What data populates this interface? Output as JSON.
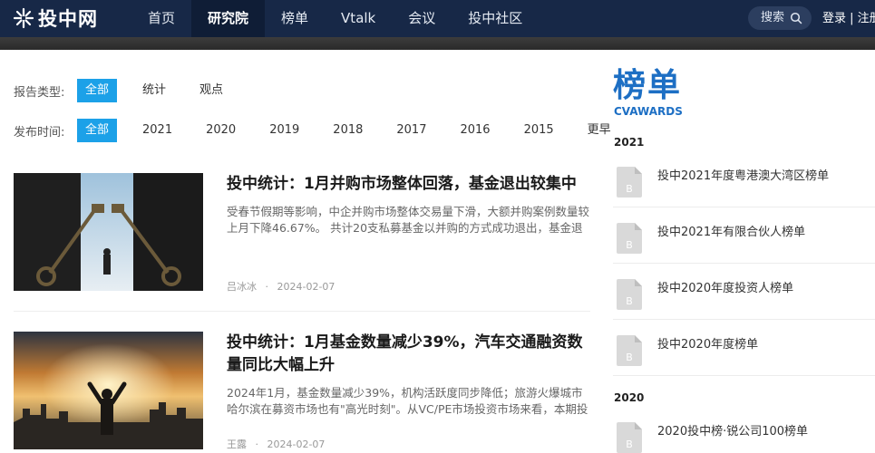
{
  "header": {
    "logo_text": "投中网",
    "nav": [
      {
        "label": "首页"
      },
      {
        "label": "研究院"
      },
      {
        "label": "榜单"
      },
      {
        "label": "Vtalk"
      },
      {
        "label": "会议"
      },
      {
        "label": "投中社区"
      }
    ],
    "active_nav": "研究院",
    "search_label": "搜索",
    "auth_label": "登录 | 注册"
  },
  "filters": {
    "type_label": "报告类型:",
    "type_options": [
      "全部",
      "统计",
      "观点"
    ],
    "time_label": "发布时间:",
    "time_options": [
      "全部",
      "2021",
      "2020",
      "2019",
      "2018",
      "2017",
      "2016",
      "2015",
      "更早"
    ],
    "active_color": "#1ca1e8"
  },
  "articles": [
    {
      "title": "投中统计：1月并购市场整体回落，基金退出较集中",
      "summary": "受春节假期等影响，中企并购市场整体交易量下滑，大额并购案例数量较上月下降46.67%。 共计20支私募基金以并购的方式成功退出，基金退出...",
      "author": "吕冰冰",
      "sep": "·",
      "date": "2024-02-07"
    },
    {
      "title": "投中统计：1月基金数量减少39%，汽车交通融资数量同比大幅上升",
      "summary": "2024年1月，基金数量减少39%，机构活跃度同步降低；旅游火爆城市哈尔滨在募资市场也有\"高光时刻\"。从VC/PE市场投资市场来看，本期投资规...",
      "author": "王露",
      "sep": "·",
      "date": "2024-02-07"
    }
  ],
  "sidebar": {
    "logo_text": "榜单",
    "logo_sub": "CVAWARDS",
    "groups": [
      {
        "year": "2021",
        "items": [
          {
            "label": "投中2021年度粤港澳大湾区榜单"
          },
          {
            "label": "投中2021年有限合伙人榜单"
          },
          {
            "label": "投中2020年度投资人榜单"
          },
          {
            "label": "投中2020年度榜单"
          }
        ]
      },
      {
        "year": "2020",
        "items": [
          {
            "label": "2020投中榜·锐公司100榜单"
          }
        ]
      }
    ],
    "icon_letter": "B",
    "brand_color": "#1d6fc4"
  },
  "colors": {
    "nav_bg": "#172847",
    "accent": "#1ca1e8"
  }
}
